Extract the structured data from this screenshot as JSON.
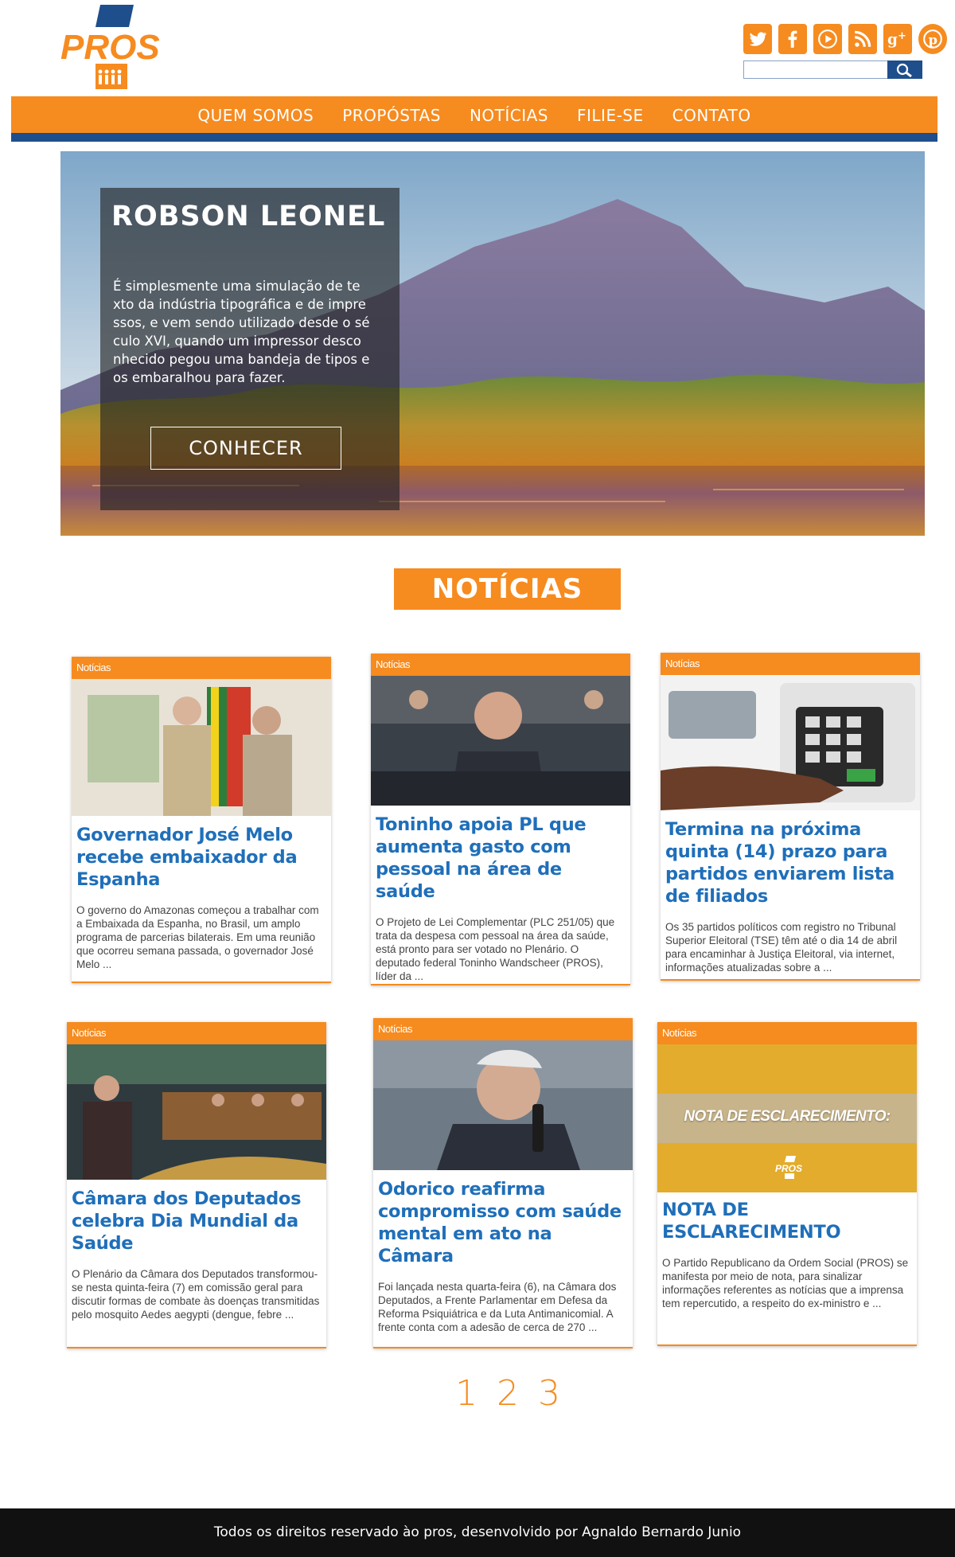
{
  "brand": {
    "name": "PROS",
    "orange": "#f68b1f",
    "blue": "#1f4e8c",
    "link_blue": "#1f6fba"
  },
  "social": [
    {
      "name": "twitter-icon"
    },
    {
      "name": "facebook-icon"
    },
    {
      "name": "youtube-icon"
    },
    {
      "name": "rss-icon"
    },
    {
      "name": "google-plus-icon"
    },
    {
      "name": "pinterest-icon"
    }
  ],
  "search": {
    "placeholder": "",
    "icon": "search-icon"
  },
  "nav": [
    "QUEM SOMOS",
    "PROPÓSTAS",
    "NOTÍCIAS",
    "FILIE-SE",
    "CONTATO"
  ],
  "hero": {
    "title": "ROBSON LEONEL",
    "text": "É simplesmente uma simulação de te xto da indústria tipográfica e de impre ssos, e vem sendo utilizado desde o sé culo XVI, quando um impressor desco nhecido pegou uma bandeja de tipos  e os embaralhou para fazer.",
    "button": "CONHECER"
  },
  "section_title": "NOTÍCIAS",
  "news": [
    {
      "tag": "Notícias",
      "title": "Governador José Melo recebe embaixador da Espanha",
      "text": "O governo do Amazonas começou a trabalhar com a Embaixada da Espanha, no Brasil, um amplo programa de parcerias bilaterais. Em uma reunião que ocorreu semana passada, o governador José Melo ..."
    },
    {
      "tag": "Notícias",
      "title": "Toninho apoia PL que aumenta gasto com pessoal na área de saúde",
      "text": "O Projeto de Lei Complementar (PLC 251/05) que trata da despesa com pessoal na área da saúde, está pronto para ser votado no Plenário. O deputado federal Toninho Wandscheer (PROS), líder da ..."
    },
    {
      "tag": "Notícias",
      "title": "Termina na próxima quinta (14) prazo para partidos enviarem lista de filiados",
      "text": "Os 35 partidos políticos com registro no Tribunal Superior Eleitoral (TSE) têm até o dia 14 de abril para encaminhar à Justiça Eleitoral, via internet, informações atualizadas sobre a ..."
    },
    {
      "tag": "Notícias",
      "title": "Câmara dos Deputados celebra Dia Mundial da Saúde",
      "text": "O Plenário da Câmara dos Deputados transformou-se nesta quinta-feira (7) em comissão geral para discutir formas de combate às doenças transmitidas pelo mosquito Aedes aegypti (dengue, febre ..."
    },
    {
      "tag": "Notícias",
      "title": "Odorico reafirma compromisso com saúde mental em ato na Câmara",
      "text": "Foi lançada nesta quarta-feira (6), na Câmara dos Deputados, a Frente Parlamentar em Defesa da Reforma Psiquiátrica e da Luta Antimanicomial. A frente conta com a adesão de cerca de 270 ..."
    },
    {
      "tag": "Notícias",
      "title": "NOTA DE ESCLARECIMENTO",
      "image_caption": "NOTA DE ESCLARECIMENTO:",
      "text": "O Partido Republicano da Ordem Social (PROS) se manifesta por meio de nota, para sinalizar informações referentes as notícias que a imprensa tem repercutido, a respeito do ex-ministro e ..."
    }
  ],
  "pagination": [
    "1",
    "2",
    "3"
  ],
  "footer": "Todos os direitos reservado ào pros, desenvolvido por Agnaldo Bernardo Junio"
}
